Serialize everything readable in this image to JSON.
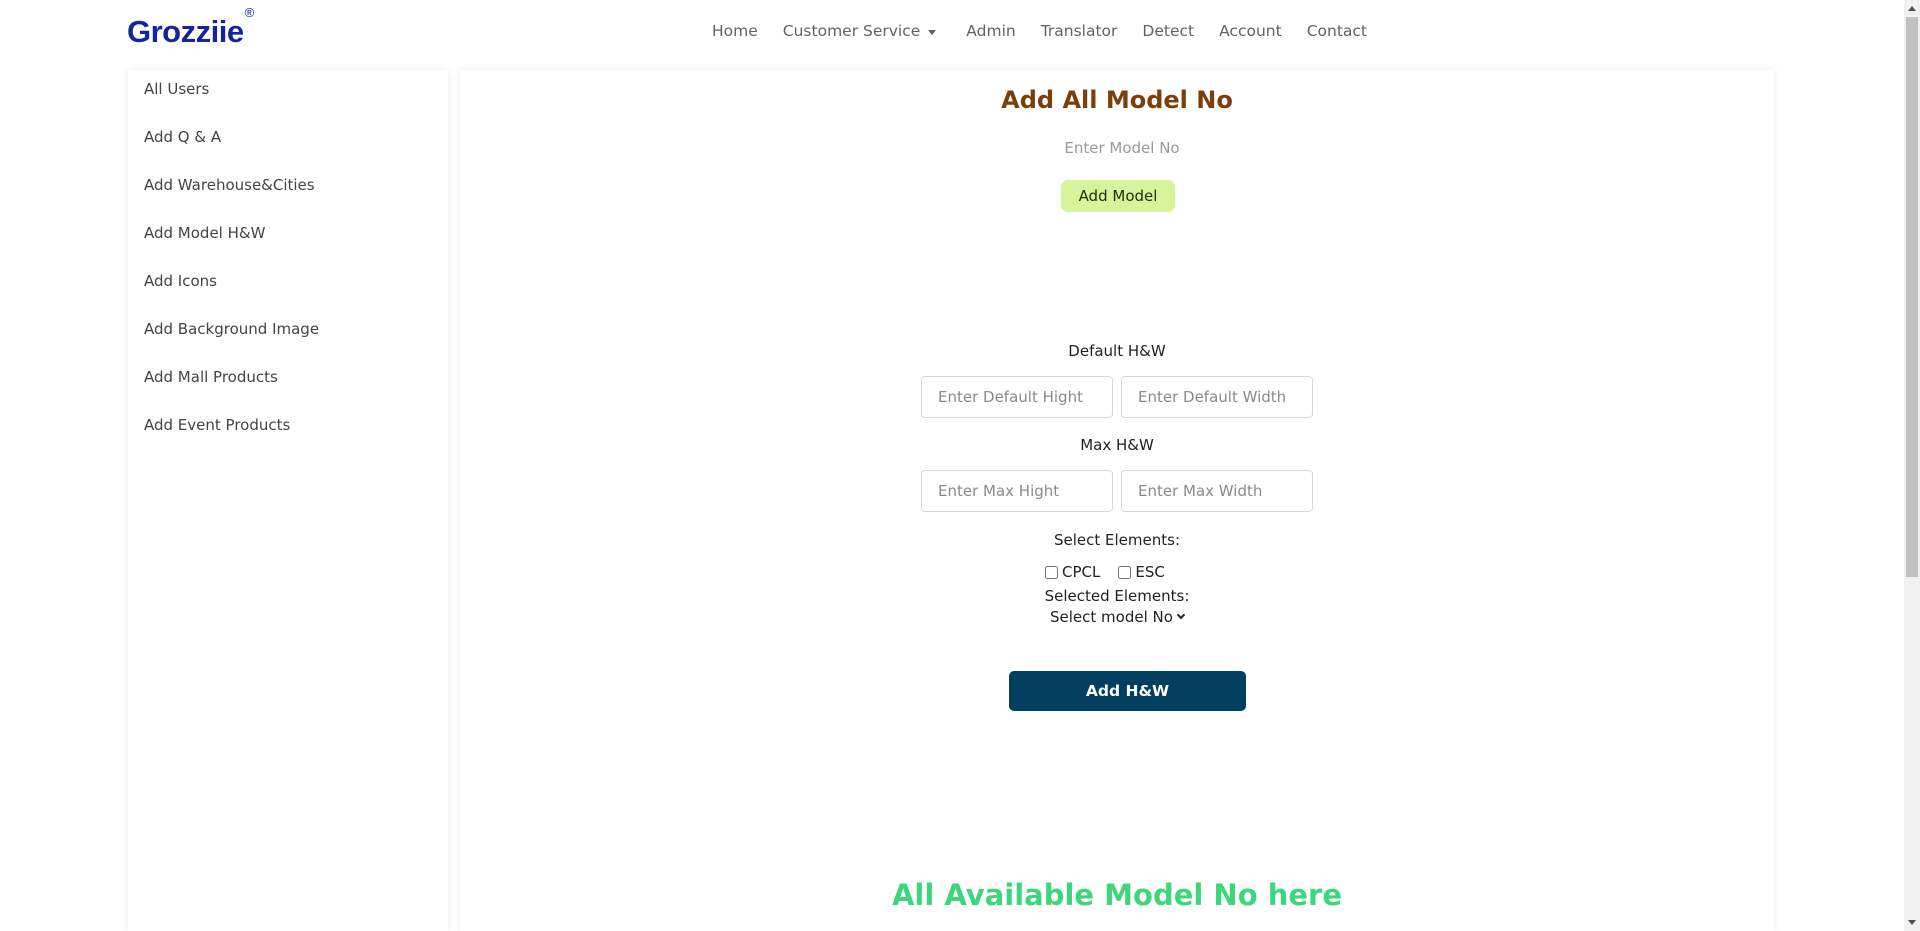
{
  "header": {
    "brand": "Grozziie",
    "brand_mark": "®",
    "nav": [
      {
        "label": "Home"
      },
      {
        "label": "Customer Service"
      },
      {
        "label": "Admin"
      },
      {
        "label": "Translator"
      },
      {
        "label": "Detect"
      },
      {
        "label": "Account"
      },
      {
        "label": "Contact"
      }
    ]
  },
  "sidebar": {
    "items": [
      {
        "label": "All Users"
      },
      {
        "label": "Add Q & A"
      },
      {
        "label": "Add Warehouse&Cities"
      },
      {
        "label": "Add Model H&W"
      },
      {
        "label": "Add Icons"
      },
      {
        "label": "Add Background Image"
      },
      {
        "label": "Add Mall Products"
      },
      {
        "label": "Add Event Products"
      }
    ]
  },
  "main": {
    "add_model_title": "Add All Model No",
    "model_input_placeholder": "Enter Model No",
    "add_model_button": "Add Model",
    "default_hw_label": "Default H&W",
    "default_height_placeholder": "Enter Default Hight",
    "default_width_placeholder": "Enter Default Width",
    "max_hw_label": "Max H&W",
    "max_height_placeholder": "Enter Max Hight",
    "max_width_placeholder": "Enter Max Width",
    "select_elements_label": "Select Elements:",
    "checkbox_cpcl": "CPCL",
    "checkbox_esc": "ESC",
    "selected_elements_label": "Selected Elements:",
    "select_model_value": "Select model No",
    "add_hw_button": "Add H&W",
    "available_title": "All Available Model No here"
  },
  "colors": {
    "brand": "#14259a",
    "add_model_title": "#7b3f0b",
    "add_model_button_bg": "#d6f59b",
    "add_hw_button_bg": "#023f5f",
    "available_title": "#3ed67a"
  }
}
